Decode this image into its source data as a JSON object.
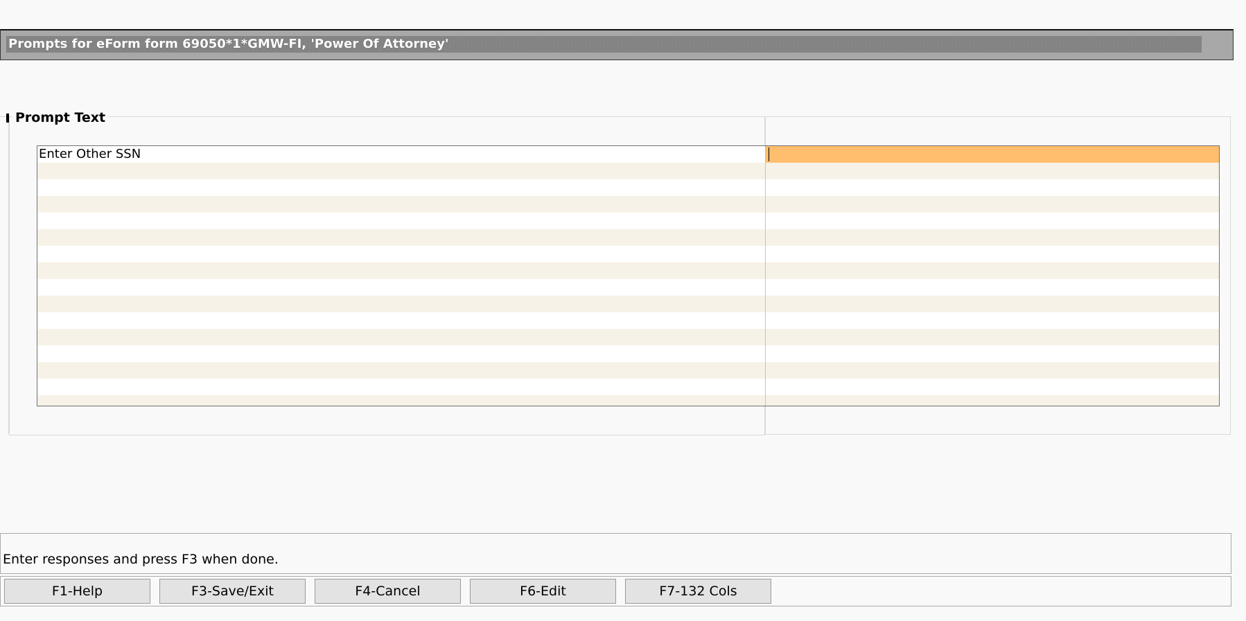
{
  "window": {
    "title": "Prompts for eForm form 69050*1*GMW-FI, 'Power Of Attorney'"
  },
  "group": {
    "label": "Prompt Text"
  },
  "grid": {
    "rows": [
      {
        "prompt": "Enter Other SSN",
        "response": ""
      }
    ]
  },
  "status": {
    "message": "Enter responses and press F3 when done."
  },
  "function_keys": [
    {
      "label": "F1-Help"
    },
    {
      "label": "F3-Save/Exit"
    },
    {
      "label": "F4-Cancel"
    },
    {
      "label": "F6-Edit"
    },
    {
      "label": "F7-132 Cols"
    }
  ],
  "colors": {
    "active_cell": "#ffbd6e",
    "stripe": "#f7f2e7",
    "title_bar": "#8a8a8a"
  }
}
